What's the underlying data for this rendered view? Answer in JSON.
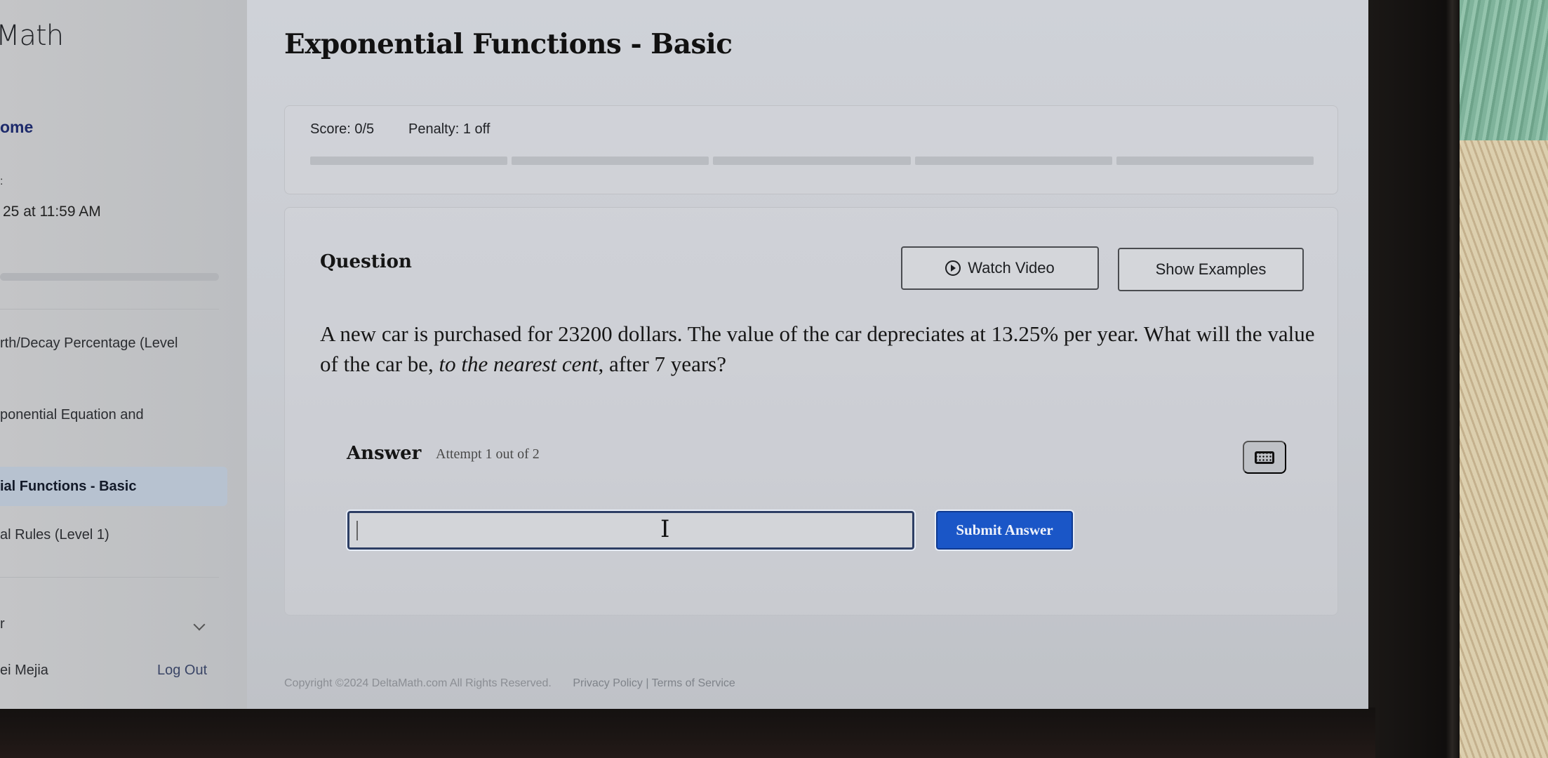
{
  "sidebar": {
    "logo_fragment": "Math",
    "home_fragment": "ome",
    "due_label_fragment": ":",
    "due_fragment": "25 at 11:59 AM",
    "items": [
      {
        "label": "rth/Decay Percentage (Level",
        "active": false
      },
      {
        "label": "ponential Equation and",
        "active": false
      },
      {
        "label": "ial Functions - Basic",
        "active": true
      },
      {
        "label": "al Rules (Level 1)",
        "active": false
      }
    ],
    "section_fragment": "r",
    "user_fragment": "ei Mejia",
    "logout_label": "Log Out"
  },
  "main": {
    "title": "Exponential Functions - Basic",
    "score": {
      "score_text": "Score: 0/5",
      "penalty_text": "Penalty: 1 off",
      "progress_total": 5,
      "progress_completed": 0
    },
    "question": {
      "label": "Question",
      "watch_video_label": "Watch Video",
      "show_examples_label": "Show Examples",
      "text_part1": "A new car is purchased for 23200 dollars. The value of the car depreciates at 13.25% per year. What will the value of the car be, ",
      "text_italic": "to the nearest cent",
      "text_part2": ", after 7 years?"
    },
    "answer": {
      "label": "Answer",
      "attempt_text": "Attempt 1 out of 2",
      "input_value": "",
      "submit_label": "Submit Answer"
    },
    "footer": {
      "copyright": "Copyright ©2024 DeltaMath.com All Rights Reserved.",
      "links": "Privacy Policy | Terms of Service"
    }
  },
  "colors": {
    "submit_blue": "#1a56c7",
    "active_item_bg": "#b7c2d0",
    "home_link": "#1d2a6b"
  }
}
